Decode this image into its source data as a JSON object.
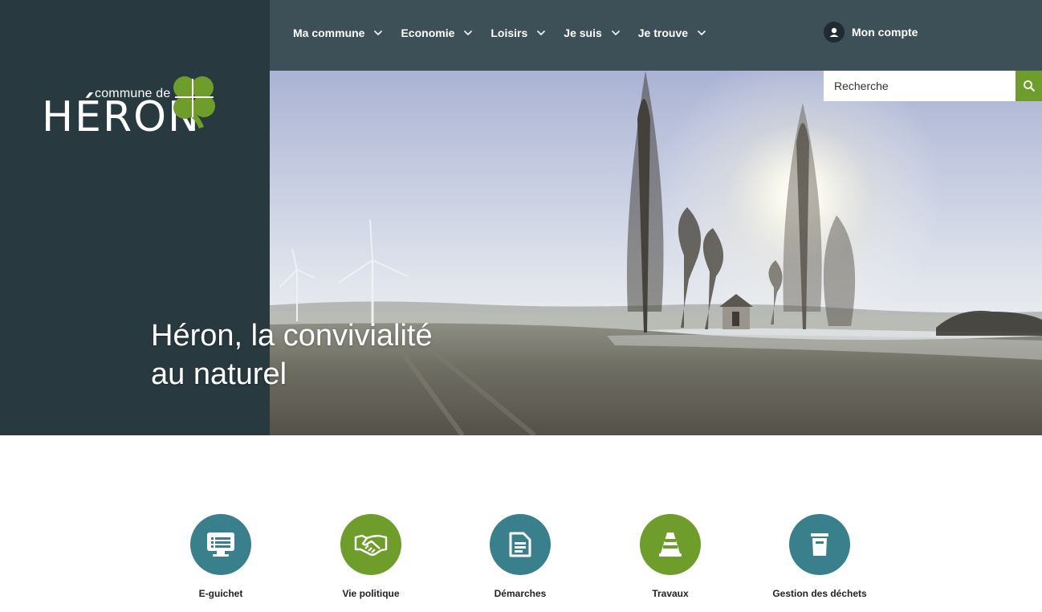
{
  "brand": {
    "small": "commune de",
    "big": "HÉRON",
    "colors": {
      "dark": "#283940",
      "nav": "#3d4f57",
      "green": "#6f9d2c",
      "teal": "#3a7f8c"
    }
  },
  "nav": {
    "items": [
      {
        "label": "Ma commune"
      },
      {
        "label": "Economie"
      },
      {
        "label": "Loisirs"
      },
      {
        "label": "Je suis"
      },
      {
        "label": "Je trouve"
      }
    ],
    "account_label": "Mon compte"
  },
  "search": {
    "placeholder": "Recherche",
    "icon": "search-icon"
  },
  "hero": {
    "headline_line1": "Héron, la convivialité",
    "headline_line2": "au naturel"
  },
  "quick_links": [
    {
      "label": "E-guichet",
      "icon": "monitor-icon",
      "color": "teal"
    },
    {
      "label": "Vie politique",
      "icon": "handshake-icon",
      "color": "green"
    },
    {
      "label": "Démarches",
      "icon": "document-icon",
      "color": "teal"
    },
    {
      "label": "Travaux",
      "icon": "traffic-cone-icon",
      "color": "green"
    },
    {
      "label": "Gestion des déchets",
      "icon": "trash-bin-icon",
      "color": "teal"
    }
  ]
}
